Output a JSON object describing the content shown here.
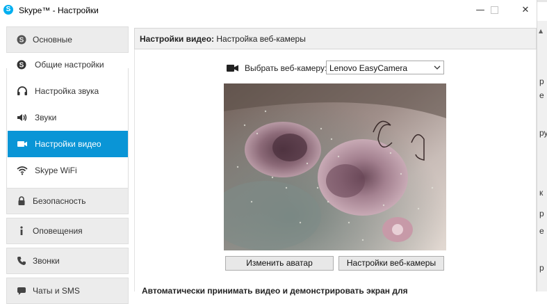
{
  "window": {
    "title": "Skype™ - Настройки",
    "app_icon_letter": "S",
    "minimize_glyph": "—",
    "close_glyph": "✕"
  },
  "sidebar": {
    "groups": [
      {
        "label": "Основные",
        "icon": "skype-icon"
      },
      {
        "label": "Безопасность",
        "icon": "lock-icon"
      },
      {
        "label": "Оповещения",
        "icon": "info-icon"
      },
      {
        "label": "Звонки",
        "icon": "phone-icon"
      },
      {
        "label": "Чаты и SMS",
        "icon": "chat-icon"
      }
    ],
    "items": [
      {
        "label": "Общие настройки",
        "icon": "skype-icon"
      },
      {
        "label": "Настройка звука",
        "icon": "headset-icon"
      },
      {
        "label": "Звуки",
        "icon": "speaker-icon"
      },
      {
        "label": "Настройки видео",
        "icon": "video-camera-icon",
        "active": true
      },
      {
        "label": "Skype WiFi",
        "icon": "wifi-icon"
      }
    ]
  },
  "main": {
    "header_bold": "Настройки видео:",
    "header_rest": " Настройка веб-камеры",
    "camera_label": "Выбрать веб-камеру:",
    "camera_value": "Lenovo EasyCamera",
    "change_avatar_button": "Изменить аватар",
    "webcam_settings_button": "Настройки веб-камеры",
    "cut_off_text": "Автоматически принимать видео и демонстрировать экран для"
  },
  "background_page": {
    "right_edge_chars": [
      "р",
      "е",
      "ру",
      "к",
      "р",
      "е",
      "р"
    ]
  },
  "colors": {
    "accent": "#0a95d6",
    "skype_blue": "#00aff0",
    "group_bg": "#ececec"
  }
}
